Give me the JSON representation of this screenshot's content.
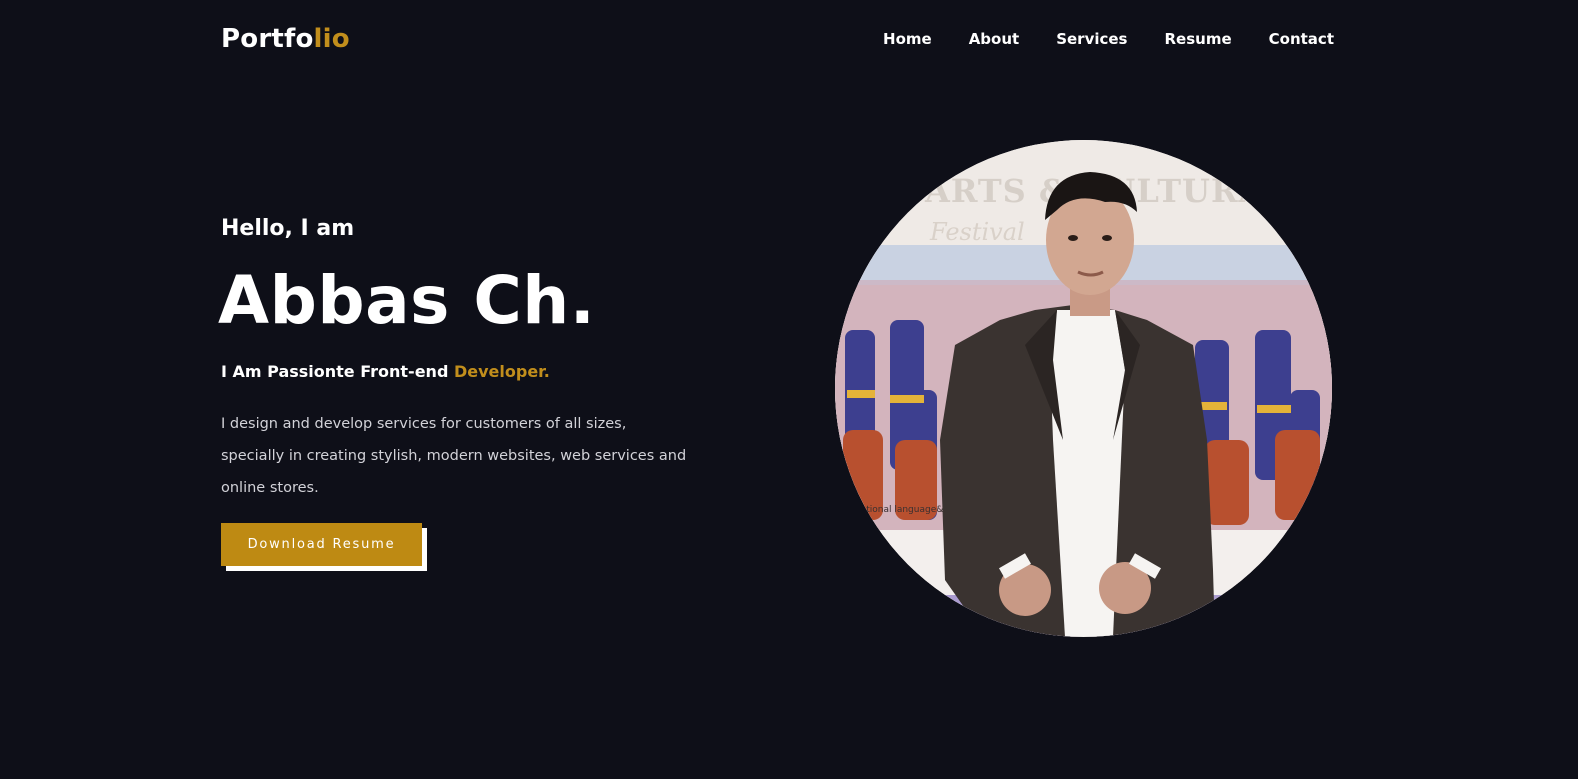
{
  "header": {
    "logo_main": "Portfo",
    "logo_accent": "lio",
    "nav": [
      "Home",
      "About",
      "Services",
      "Resume",
      "Contact"
    ]
  },
  "hero": {
    "greeting": "Hello, I am",
    "name": "Abbas Ch.",
    "tagline_main": "I Am Passionte Front-end",
    "tagline_accent": "Developer.",
    "description": "I design and develop services for customers of all sizes, specially in creating stylish, modern websites, web services and online stores.",
    "button_label": "Download Resume",
    "photo_banner_text": "ARTS & CULTURAL SPORTS",
    "photo_festival_text": "Festival",
    "photo_small_text": "national language&culture"
  },
  "colors": {
    "background": "#0e0f18",
    "accent": "#c18e1c",
    "button": "#be8a13",
    "text": "#ffffff",
    "muted_text": "#d2d2d8"
  }
}
